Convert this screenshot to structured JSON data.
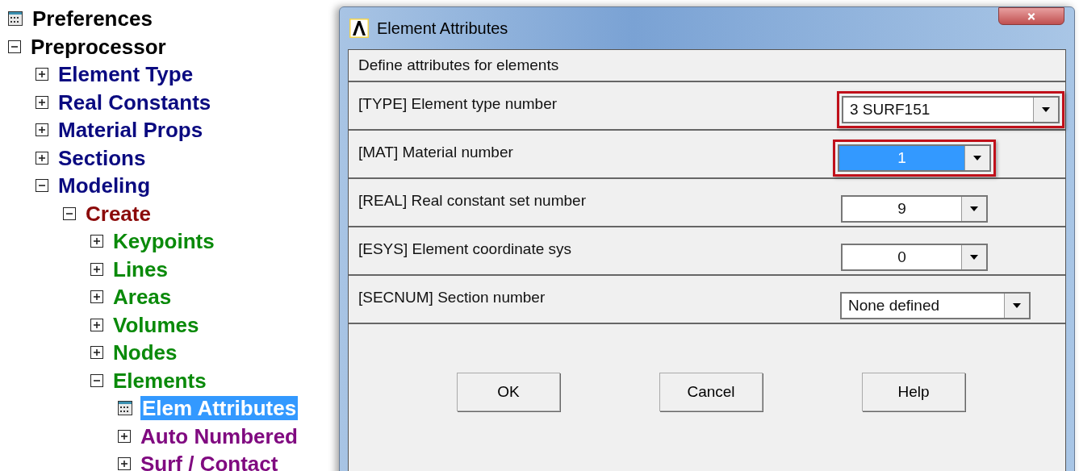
{
  "tree": [
    {
      "label": "Preferences",
      "kind": "action",
      "color": "#000000",
      "selected": false
    },
    {
      "label": "Preprocessor",
      "kind": "folder",
      "expanded": true,
      "color": "#000000",
      "selected": false,
      "children": [
        {
          "label": "Element Type",
          "kind": "folder",
          "expanded": false,
          "color": "#0a0a80",
          "selected": false
        },
        {
          "label": "Real Constants",
          "kind": "folder",
          "expanded": false,
          "color": "#0a0a80",
          "selected": false
        },
        {
          "label": "Material Props",
          "kind": "folder",
          "expanded": false,
          "color": "#0a0a80",
          "selected": false
        },
        {
          "label": "Sections",
          "kind": "folder",
          "expanded": false,
          "color": "#0a0a80",
          "selected": false
        },
        {
          "label": "Modeling",
          "kind": "folder",
          "expanded": true,
          "color": "#0a0a80",
          "selected": false,
          "children": [
            {
              "label": "Create",
              "kind": "folder",
              "expanded": true,
              "color": "#8b0a0a",
              "selected": false,
              "children": [
                {
                  "label": "Keypoints",
                  "kind": "folder",
                  "expanded": false,
                  "color": "#0a8a0a",
                  "selected": false
                },
                {
                  "label": "Lines",
                  "kind": "folder",
                  "expanded": false,
                  "color": "#0a8a0a",
                  "selected": false
                },
                {
                  "label": "Areas",
                  "kind": "folder",
                  "expanded": false,
                  "color": "#0a8a0a",
                  "selected": false
                },
                {
                  "label": "Volumes",
                  "kind": "folder",
                  "expanded": false,
                  "color": "#0a8a0a",
                  "selected": false
                },
                {
                  "label": "Nodes",
                  "kind": "folder",
                  "expanded": false,
                  "color": "#0a8a0a",
                  "selected": false
                },
                {
                  "label": "Elements",
                  "kind": "folder",
                  "expanded": true,
                  "color": "#0a8a0a",
                  "selected": false,
                  "children": [
                    {
                      "label": "Elem Attributes",
                      "kind": "action",
                      "selected": true
                    },
                    {
                      "label": "Auto Numbered",
                      "kind": "folder",
                      "expanded": false,
                      "color": "#800a80",
                      "selected": false
                    },
                    {
                      "label": "Surf / Contact",
                      "kind": "folder",
                      "expanded": false,
                      "color": "#800a80",
                      "selected": false
                    }
                  ]
                }
              ]
            }
          ]
        }
      ]
    }
  ],
  "dialog": {
    "title": "Element Attributes",
    "heading": "Define attributes for elements",
    "fields": [
      {
        "label": "[TYPE]  Element type number",
        "value": "3   SURF151",
        "kind": "text",
        "highlighted": true,
        "selected": false
      },
      {
        "label": "[MAT]   Material number",
        "value": "1",
        "kind": "number",
        "highlighted": true,
        "selected": true
      },
      {
        "label": "[REAL]  Real constant set number",
        "value": "9",
        "kind": "number",
        "highlighted": false,
        "selected": false
      },
      {
        "label": "[ESYS]  Element coordinate sys",
        "value": "0",
        "kind": "number",
        "highlighted": false,
        "selected": false
      },
      {
        "label": "[SECNUM]  Section number",
        "value": "None defined",
        "kind": "text",
        "highlighted": false,
        "selected": false
      }
    ],
    "buttons": [
      "OK",
      "Cancel",
      "Help"
    ]
  }
}
